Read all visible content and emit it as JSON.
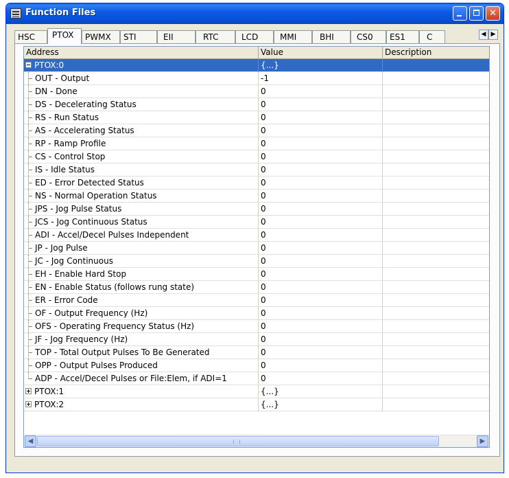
{
  "window": {
    "title": "Function Files"
  },
  "tabs": [
    "HSC",
    "PTOX",
    "PWMX",
    "STI",
    "EII",
    "RTC",
    "LCD",
    "MMI",
    "BHI",
    "CS0",
    "ES1",
    "C"
  ],
  "active_tab": "PTOX",
  "columns": {
    "address": "Address",
    "value": "Value",
    "description": "Description"
  },
  "rows": [
    {
      "address": "PTOX:0",
      "value": "{...}",
      "kind": "expanded",
      "selected": true
    },
    {
      "address": "OUT - Output",
      "value": "-1"
    },
    {
      "address": "DN - Done",
      "value": "0"
    },
    {
      "address": "DS - Decelerating Status",
      "value": "0"
    },
    {
      "address": "RS - Run Status",
      "value": "0"
    },
    {
      "address": "AS - Accelerating Status",
      "value": "0"
    },
    {
      "address": "RP - Ramp Profile",
      "value": "0"
    },
    {
      "address": "CS - Control Stop",
      "value": "0"
    },
    {
      "address": "IS - Idle Status",
      "value": "0"
    },
    {
      "address": "ED - Error Detected Status",
      "value": "0"
    },
    {
      "address": "NS - Normal Operation Status",
      "value": "0"
    },
    {
      "address": "JPS - Jog Pulse Status",
      "value": "0"
    },
    {
      "address": "JCS - Jog Continuous Status",
      "value": "0"
    },
    {
      "address": "ADI - Accel/Decel Pulses Independent",
      "value": "0"
    },
    {
      "address": "JP - Jog Pulse",
      "value": "0"
    },
    {
      "address": "JC - Jog Continuous",
      "value": "0"
    },
    {
      "address": "EH - Enable Hard Stop",
      "value": "0"
    },
    {
      "address": "EN - Enable Status (follows rung state)",
      "value": "0"
    },
    {
      "address": "ER - Error Code",
      "value": "0"
    },
    {
      "address": "OF - Output Frequency (Hz)",
      "value": "0"
    },
    {
      "address": "OFS - Operating Frequency Status (Hz)",
      "value": "0"
    },
    {
      "address": "JF - Jog Frequency (Hz)",
      "value": "0"
    },
    {
      "address": "TOP - Total Output Pulses To Be Generated",
      "value": "0"
    },
    {
      "address": "OPP - Output Pulses Produced",
      "value": "0"
    },
    {
      "address": "ADP - Accel/Decel Pulses or File:Elem, if ADI=1",
      "value": "0",
      "last": true
    },
    {
      "address": "PTOX:1",
      "value": "{...}",
      "kind": "collapsed"
    },
    {
      "address": "PTOX:2",
      "value": "{...}",
      "kind": "collapsed"
    }
  ]
}
